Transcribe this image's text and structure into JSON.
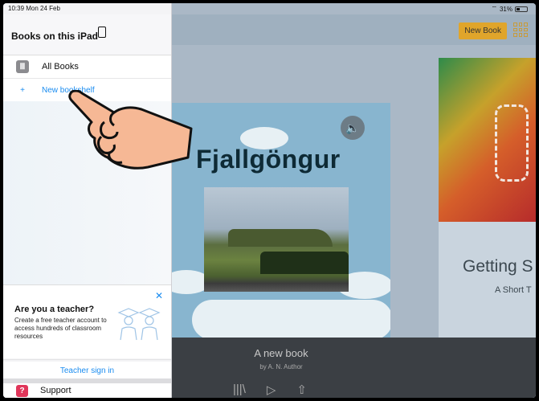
{
  "status_bar": {
    "time": "10:39  Mon 24 Feb",
    "battery": "31%"
  },
  "toolbar": {
    "new_book_label": "New Book"
  },
  "sidebar": {
    "title": "Books on this iPad",
    "items": [
      {
        "label": "All Books",
        "icon": "books-icon"
      },
      {
        "label": "New bookshelf",
        "icon": "plus-icon"
      }
    ]
  },
  "teacher_banner": {
    "heading": "Are you a teacher?",
    "description": "Create a free teacher account to access hundreds of classroom resources",
    "sign_in_label": "Teacher sign in"
  },
  "support": {
    "label": "Support"
  },
  "current_book": {
    "cover_title": "Fjallgöngur",
    "title": "A new book",
    "author": "by A. N. Author"
  },
  "next_book": {
    "title": "Getting S",
    "subtitle": "A Short T"
  },
  "colors": {
    "accent": "#1a8cf0",
    "new_book_button": "#e0a52b",
    "support_icon": "#e0365a"
  }
}
